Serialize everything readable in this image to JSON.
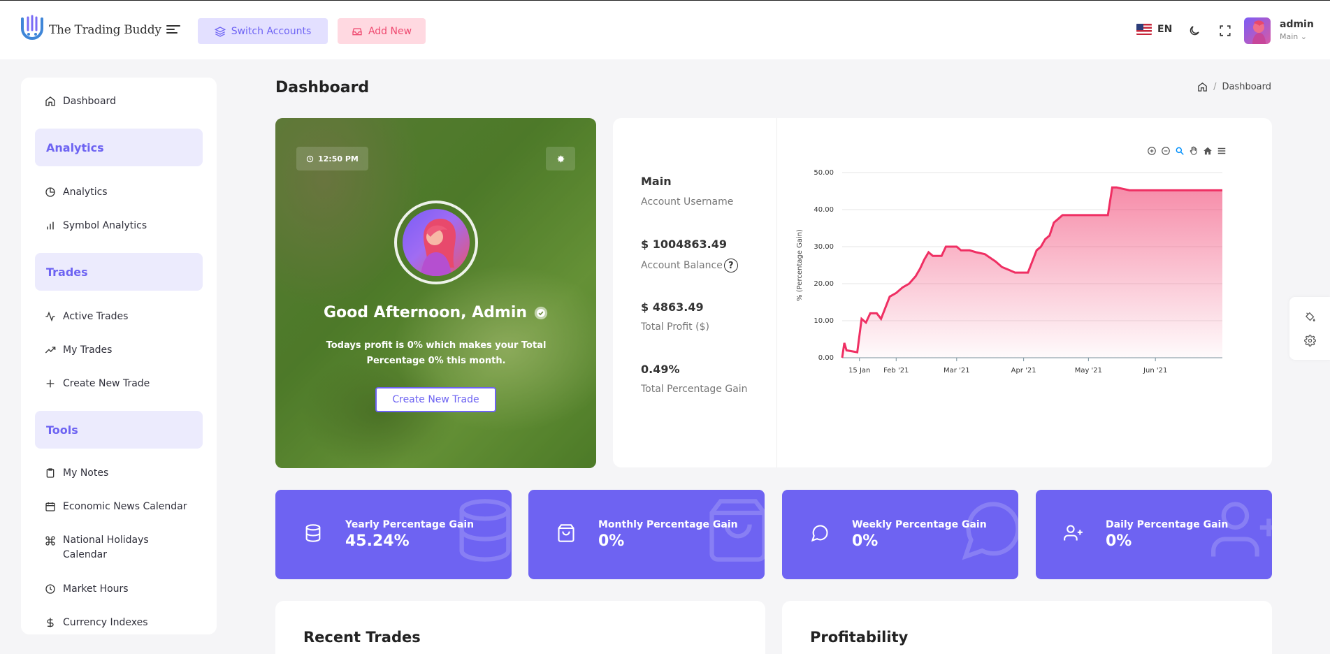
{
  "app": {
    "logo_text": "The Trading Buddy",
    "switch_accounts": "Switch Accounts",
    "add_new": "Add New",
    "language": "EN",
    "user_name": "admin",
    "user_role": "Main"
  },
  "sidebar": {
    "dashboard": "Dashboard",
    "sections": {
      "analytics": "Analytics",
      "trades": "Trades",
      "tools": "Tools"
    },
    "analytics_items": [
      "Analytics",
      "Symbol Analytics"
    ],
    "trades_items": [
      "Active Trades",
      "My Trades",
      "Create New Trade"
    ],
    "tools_items": [
      "My Notes",
      "Economic News Calendar",
      "National Holidays Calendar",
      "Market Hours",
      "Currency Indexes"
    ]
  },
  "page": {
    "title": "Dashboard",
    "breadcrumb": "Dashboard"
  },
  "welcome": {
    "time": "12:50 PM",
    "greeting": "Good Afternoon, Admin",
    "message": "Todays profit is 0% which makes your Total Percentage 0% this month.",
    "button": "Create New Trade"
  },
  "stats": {
    "username_value": "Main",
    "username_label": "Account Username",
    "balance_value": "$ 1004863.49",
    "balance_label": "Account Balance",
    "profit_value": "$ 4863.49",
    "profit_label": "Total Profit ($)",
    "gain_value": "0.49%",
    "gain_label": "Total Percentage Gain"
  },
  "kpis": [
    {
      "label": "Yearly Percentage Gain",
      "value": "45.24%"
    },
    {
      "label": "Monthly Percentage Gain",
      "value": "0%"
    },
    {
      "label": "Weekly Percentage Gain",
      "value": "0%"
    },
    {
      "label": "Daily Percentage Gain",
      "value": "0%"
    }
  ],
  "panels": {
    "recent_trades": "Recent Trades",
    "profitability": "Profitability"
  },
  "colors": {
    "accent": "#6e63f2",
    "line": "#ef2f63",
    "add_button": "#ef4a70"
  },
  "chart_data": {
    "type": "area",
    "ylabel": "% (Percentage Gain)",
    "xlabel": "",
    "ylim": [
      0,
      50
    ],
    "y_ticks": [
      "0.00",
      "10.00",
      "20.00",
      "30.00",
      "40.00",
      "50.00"
    ],
    "x_ticks": [
      {
        "label": "15 Jan",
        "date": "2021-01-15"
      },
      {
        "label": "Feb '21",
        "date": "2021-02-01"
      },
      {
        "label": "Mar '21",
        "date": "2021-03-01"
      },
      {
        "label": "Apr '21",
        "date": "2021-04-01"
      },
      {
        "label": "May '21",
        "date": "2021-05-01"
      },
      {
        "label": "Jun '21",
        "date": "2021-06-01"
      }
    ],
    "x_range": [
      "2021-01-07",
      "2021-07-02"
    ],
    "series": [
      {
        "x": [
          "2021-01-07",
          "2021-01-08",
          "2021-01-09",
          "2021-01-14",
          "2021-01-16",
          "2021-01-18",
          "2021-01-20",
          "2021-01-23",
          "2021-01-25",
          "2021-01-29",
          "2021-02-01",
          "2021-02-04",
          "2021-02-07",
          "2021-02-10",
          "2021-02-12",
          "2021-02-14",
          "2021-02-16",
          "2021-02-18",
          "2021-02-20",
          "2021-02-22",
          "2021-02-24",
          "2021-02-26",
          "2021-03-01",
          "2021-03-03",
          "2021-03-07",
          "2021-03-10",
          "2021-03-14",
          "2021-03-19",
          "2021-03-22",
          "2021-03-24",
          "2021-03-26",
          "2021-03-28",
          "2021-04-03",
          "2021-04-07",
          "2021-04-09",
          "2021-04-11",
          "2021-04-13",
          "2021-04-15",
          "2021-04-17",
          "2021-04-19",
          "2021-04-25",
          "2021-04-30",
          "2021-05-10",
          "2021-05-12",
          "2021-05-14",
          "2021-05-20",
          "2021-05-25",
          "2021-07-02"
        ],
        "values": [
          0,
          4,
          2,
          1.5,
          10.5,
          9.5,
          12,
          12,
          10.5,
          16.5,
          17.5,
          19,
          20,
          22,
          24,
          26.5,
          28.5,
          27.5,
          27.5,
          27.5,
          30,
          30,
          30,
          29,
          29,
          28.5,
          28,
          26,
          24.5,
          24,
          23.5,
          23,
          23,
          29,
          30,
          32,
          33,
          36.5,
          37.5,
          38.5,
          38.5,
          38.5,
          38.5,
          46,
          46,
          45.2,
          45.2,
          45.2
        ]
      }
    ]
  }
}
